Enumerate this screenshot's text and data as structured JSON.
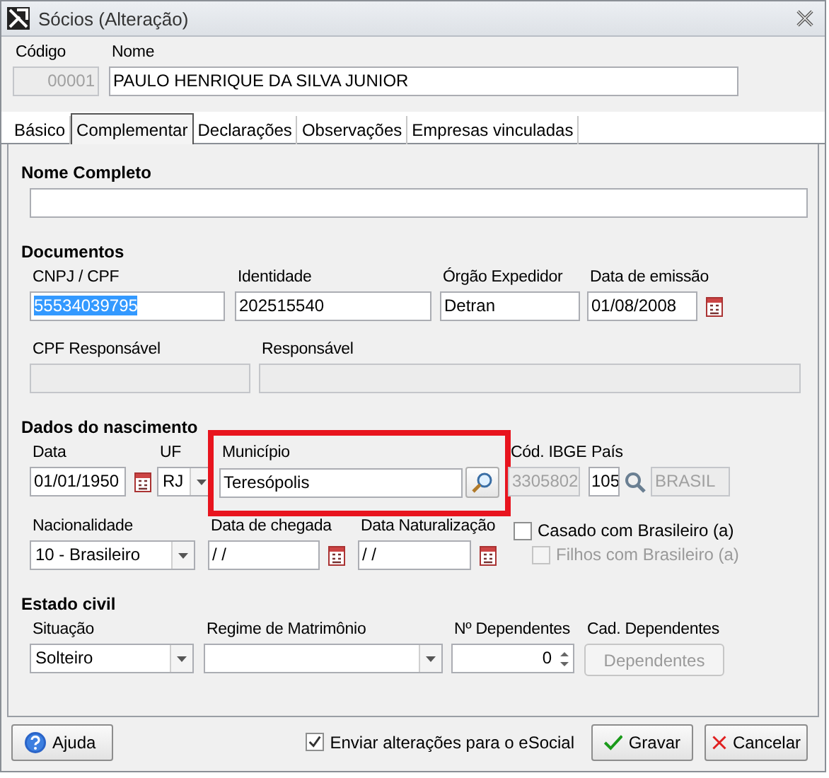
{
  "window": {
    "title": "Sócios (Alteração)"
  },
  "header": [
    {
      "label": "Código",
      "value": "00001",
      "disabled": true
    },
    {
      "label": "Nome",
      "value": "PAULO HENRIQUE DA SILVA JUNIOR",
      "disabled": false
    }
  ],
  "tabs": [
    {
      "label": "Básico",
      "selected": false
    },
    {
      "label": "Complementar",
      "selected": true
    },
    {
      "label": "Declarações",
      "selected": false
    },
    {
      "label": "Observações",
      "selected": false
    },
    {
      "label": "Empresas vinculadas",
      "selected": false
    }
  ],
  "sections": [
    {
      "title": "Nome Completo",
      "rows": [
        {
          "fields": [
            {
              "kind": "text",
              "disabled": false
            }
          ]
        }
      ]
    },
    {
      "title": "Documentos",
      "rows": [
        {
          "fields": [
            {
              "kind": "text",
              "label": "CNPJ / CPF",
              "value": "55534039795",
              "text_selected": true,
              "disabled": false
            },
            {
              "kind": "text",
              "label": "Identidade",
              "value": "202515540",
              "text_selected": false,
              "disabled": false
            },
            {
              "kind": "text",
              "label": "Órgão Expedidor",
              "value": "Detran",
              "text_selected": false,
              "disabled": false
            },
            {
              "kind": "date",
              "label": "Data de emissão",
              "value": "01/08/2008"
            }
          ]
        },
        {
          "fields": [
            {
              "kind": "text",
              "label": "CPF Responsável",
              "disabled": true
            },
            {
              "kind": "text",
              "label": "Responsável",
              "disabled": true
            }
          ]
        }
      ]
    },
    {
      "title": "Dados do nascimento",
      "rows": [
        {
          "fields": [
            {
              "kind": "date",
              "label": "Data",
              "value": "01/01/1950"
            },
            {
              "kind": "combo",
              "label": "UF",
              "value": "RJ"
            },
            {
              "kind": "lookup",
              "label": "Município",
              "value": "Teresópolis",
              "highlighted": true
            },
            {
              "kind": "text",
              "label": "Cód. IBGE",
              "value": "3305802",
              "text_selected": false,
              "disabled": true
            },
            {
              "kind": "country",
              "label": "País",
              "value": "105",
              "description": "BRASIL"
            }
          ]
        },
        {
          "fields": [
            {
              "kind": "combo",
              "label": "Nacionalidade",
              "value": "10 - Brasileiro"
            },
            {
              "kind": "date",
              "label": "Data de chegada",
              "value": " / /"
            },
            {
              "kind": "date",
              "label": "Data Naturalização",
              "value": " / /"
            },
            {
              "kind": "checks",
              "items": [
                {
                  "label": "Casado com Brasileiro (a)",
                  "checked": false,
                  "disabled": false,
                  "children": [
                    {
                      "label": "Filhos com Brasileiro (a)",
                      "checked": false,
                      "disabled": true
                    }
                  ]
                }
              ]
            }
          ]
        }
      ]
    },
    {
      "title": "Estado civil",
      "rows": [
        {
          "fields": [
            {
              "kind": "combo",
              "label": "Situação",
              "value": "Solteiro"
            },
            {
              "kind": "combo",
              "label": "Regime de Matrimônio"
            },
            {
              "kind": "spin",
              "label": "Nº Dependentes",
              "value": "0"
            },
            {
              "kind": "button",
              "label": "Cad. Dependentes",
              "button": "Dependentes",
              "disabled": true
            }
          ]
        }
      ]
    }
  ],
  "footer": {
    "help": "Ajuda",
    "esocial": {
      "label": "Enviar alterações para o eSocial",
      "checked": true
    },
    "save": "Gravar",
    "cancel": "Cancelar"
  }
}
